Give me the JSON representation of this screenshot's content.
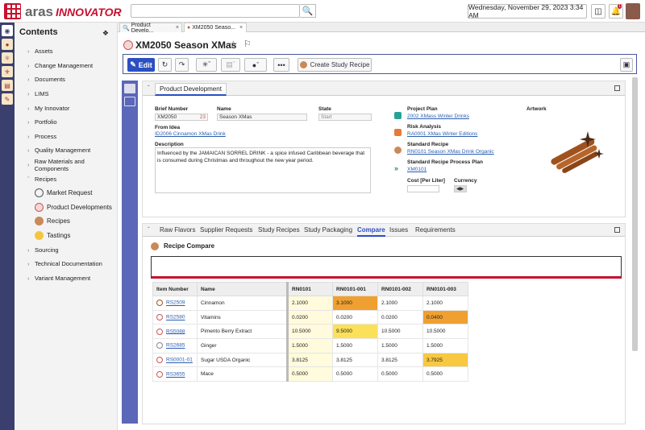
{
  "header": {
    "logo_brand": "aras",
    "logo_product": "INNOVATOR",
    "search_placeholder": "",
    "date": "Wednesday, November 29, 2023 3:34 AM",
    "notification_count": "1"
  },
  "sidebar": {
    "title": "Contents",
    "items": [
      {
        "label": "Assets"
      },
      {
        "label": "Change Management"
      },
      {
        "label": "Documents"
      },
      {
        "label": "LIMS"
      },
      {
        "label": "My Innovator"
      },
      {
        "label": "Portfolio"
      },
      {
        "label": "Process"
      },
      {
        "label": "Quality Management"
      },
      {
        "label": "Raw Materials and Components"
      },
      {
        "label": "Recipes",
        "expanded": true
      }
    ],
    "recipe_children": [
      {
        "label": "Market Request",
        "icon": "globe-icon"
      },
      {
        "label": "Product Developments",
        "icon": "product-development-icon"
      },
      {
        "label": "Recipes",
        "icon": "recipe-icon"
      },
      {
        "label": "Tastings",
        "icon": "tasting-icon"
      }
    ],
    "items_after": [
      {
        "label": "Sourcing"
      },
      {
        "label": "Technical Documentation"
      },
      {
        "label": "Variant Management"
      }
    ]
  },
  "tabs": [
    {
      "label": "Product Develo..."
    },
    {
      "label": "XM2050 Seaso..."
    }
  ],
  "item": {
    "title": "XM2050 Season XMas",
    "toolbar": {
      "edit_label": "Edit",
      "study_recipe_label": "Create Study Recipe"
    }
  },
  "form": {
    "tab_label": "Product Development",
    "brief_number_label": "Brief Number",
    "brief_number_value": "XM2050",
    "brief_number_suffix": "23",
    "name_label": "Name",
    "name_value": "Season XMas",
    "state_label": "State",
    "state_value": "Start",
    "from_idea_label": "From Idea",
    "from_idea_value": "ID2006 Cinnamon XMas Drink",
    "description_label": "Description",
    "description_value": "Influenced by the JAMAICAN SORREL DRINK - a spice infused Caribbean beverage that is consumed during Christmas and throughout the new year period.",
    "project_plan_label": "Project Plan",
    "project_plan_value": "2002 XMass Winter Drinks",
    "risk_analysis_label": "Risk Analysis",
    "risk_analysis_value": "RA0001 XMas Winter Editions",
    "standard_recipe_label": "Standard Recipe",
    "standard_recipe_value": "RN0101 Season XMas Drink Organic",
    "process_plan_label": "Standard Recipe Process Plan",
    "process_plan_value": "XM0101",
    "cost_label": "Cost [Per Liter]",
    "currency_label": "Currency",
    "artwork_label": "Artwork"
  },
  "lower_tabs": [
    {
      "label": "Raw Flavors"
    },
    {
      "label": "Supplier Requests"
    },
    {
      "label": "Study Recipes"
    },
    {
      "label": "Study Packaging"
    },
    {
      "label": "Compare",
      "active": true
    },
    {
      "label": "Issues"
    },
    {
      "label": "Requirements"
    }
  ],
  "recipe_compare": {
    "title": "Recipe Compare",
    "columns": [
      "Item Number",
      "Name",
      "RN0101",
      "RN0101-001",
      "RN0101-002",
      "RN0101-003"
    ],
    "rows": [
      {
        "item": "RS2509",
        "name": "Cinnamon",
        "v": [
          "2.1000",
          "3.1000",
          "2.1000",
          "2.1000"
        ],
        "hl": [
          "",
          "c-or",
          "",
          ""
        ]
      },
      {
        "item": "RS2580",
        "name": "Vitamins",
        "v": [
          "0.0200",
          "0.0200",
          "0.0200",
          "0.0400"
        ],
        "hl": [
          "",
          "",
          "",
          "c-or"
        ]
      },
      {
        "item": "RS5088",
        "name": "Pimento Berry Extract",
        "v": [
          "10.5000",
          "9.5000",
          "10.5000",
          "10.5000"
        ],
        "hl": [
          "",
          "c-ye",
          "",
          ""
        ]
      },
      {
        "item": "RS2685",
        "name": "Ginger",
        "v": [
          "1.5000",
          "1.5000",
          "1.5000",
          "1.5000"
        ],
        "hl": [
          "",
          "",
          "",
          ""
        ]
      },
      {
        "item": "RS0001-01",
        "name": "Sugar USDA Organic",
        "v": [
          "3.8125",
          "3.8125",
          "3.8125",
          "3.7925"
        ],
        "hl": [
          "",
          "",
          "",
          "c-lo"
        ]
      },
      {
        "item": "RS3655",
        "name": "Mace",
        "v": [
          "0.5000",
          "0.5000",
          "0.5000",
          "0.5000"
        ],
        "hl": [
          "",
          "",
          "",
          ""
        ]
      }
    ]
  }
}
